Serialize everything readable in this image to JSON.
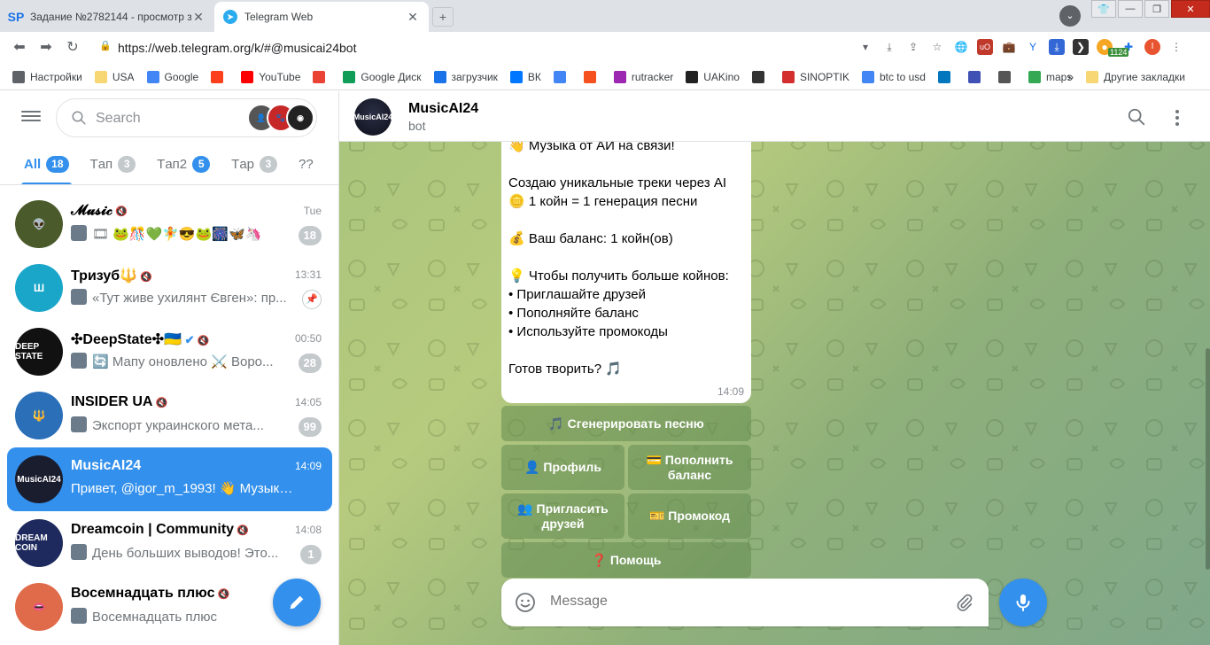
{
  "browser": {
    "tabs": [
      {
        "title": "Задание №2782144 - просмотр з",
        "favicon": "SP"
      },
      {
        "title": "Telegram Web",
        "favicon": "telegram-icon"
      }
    ],
    "profile_initial": "I",
    "url": "https://web.telegram.org/k/#@musicai24bot",
    "extension_badge": "1124",
    "bookmarks": [
      {
        "label": "Настройки",
        "icon": "gear-icon"
      },
      {
        "label": "USA",
        "icon": "folder-icon"
      },
      {
        "label": "Google",
        "icon": "google-icon"
      },
      {
        "label": "",
        "icon": "yandex-icon"
      },
      {
        "label": "YouTube",
        "icon": "youtube-icon"
      },
      {
        "label": "",
        "icon": "gmail-icon"
      },
      {
        "label": "Google Диск",
        "icon": "drive-icon"
      },
      {
        "label": "загрузчик",
        "icon": "link-icon"
      },
      {
        "label": "ВК",
        "icon": "vk-icon"
      },
      {
        "label": "",
        "icon": "translate-icon"
      },
      {
        "label": "",
        "icon": "f-icon"
      },
      {
        "label": "rutracker",
        "icon": "rutracker-icon"
      },
      {
        "label": "UAKino",
        "icon": "film-icon"
      },
      {
        "label": "",
        "icon": "chess-icon"
      },
      {
        "label": "SINOPTIK",
        "icon": "thermometer-icon"
      },
      {
        "label": "btc to usd",
        "icon": "google-icon"
      },
      {
        "label": "",
        "icon": "p-icon"
      },
      {
        "label": "",
        "icon": "arrow-icon"
      },
      {
        "label": "",
        "icon": "bc-icon"
      },
      {
        "label": "maps",
        "icon": "maps-icon"
      }
    ],
    "more_bookmarks": "»",
    "other_bookmarks": "Другие закладки"
  },
  "sidebar": {
    "search_placeholder": "Search",
    "folders": [
      {
        "label": "All",
        "count": "18",
        "active": true
      },
      {
        "label": "Tап",
        "count": "3"
      },
      {
        "label": "Tап2",
        "count": "5"
      },
      {
        "label": "Tар",
        "count": "3"
      },
      {
        "label": "??",
        "count": ""
      }
    ],
    "chats": [
      {
        "name": "𝓜𝓾𝓼𝓲𝓬",
        "muted": true,
        "time": "Tue",
        "preview": "🎞 🐸🎊💚🧚😎🐸🎆🦋🦄",
        "unread": "18",
        "avatar_color": "#4a5a2a",
        "avatar_text": "👽"
      },
      {
        "name": "Тризуб🔱",
        "muted": true,
        "time": "13:31",
        "preview": "«Тут живе ухилянт Євген»: пр...",
        "unread": "",
        "pinned": true,
        "avatar_color": "#1aa6c9",
        "avatar_text": "Ш"
      },
      {
        "name": "✣DeepState✣🇺🇦",
        "muted": true,
        "verified": true,
        "time": "00:50",
        "preview": "🔄 Мапу оновлено ⚔️ Воро...",
        "unread": "28",
        "avatar_color": "#111111",
        "avatar_text": "DEEP STATE"
      },
      {
        "name": "INSIDER UA",
        "muted": true,
        "time": "14:05",
        "preview": "Экспорт украинского мета...",
        "unread": "99",
        "avatar_color": "#2a6fb8",
        "avatar_text": "🔱"
      },
      {
        "name": "MusicAI24",
        "muted": false,
        "time": "14:09",
        "preview": "Привет, @igor_m_1993! 👋 Музыка о...",
        "unread": "",
        "active": true,
        "avatar_color": "#1a1d2e",
        "avatar_text": "MusicAI24"
      },
      {
        "name": "Dreamcoin | Community",
        "muted": true,
        "time": "14:08",
        "preview": "День больших выводов! Это...",
        "unread": "1",
        "avatar_color": "#1e2a5e",
        "avatar_text": "DREAM COIN"
      },
      {
        "name": "Восемнадцать плюс",
        "muted": true,
        "time": "",
        "preview": "Восемнадцать плюс",
        "unread": "",
        "avatar_color": "#e06b4a",
        "avatar_text": "👄"
      }
    ]
  },
  "chat": {
    "title": "MusicAI24",
    "subtitle": "bot",
    "message": {
      "lines": [
        "👋 Музыка от АИ на связи!",
        "",
        "Создаю уникальные треки через AI",
        "🪙 1 койн = 1 генерация песни",
        "",
        "💰 Ваш баланс: 1 койн(ов)",
        "",
        "💡 Чтобы получить больше койнов:",
        "• Приглашайте друзей",
        "• Пополняйте баланс",
        "• Используйте промокоды",
        "",
        "Готов творить? 🎵"
      ],
      "time": "14:09"
    },
    "keyboard": [
      [
        {
          "label": "🎵 Сгенерировать песню"
        }
      ],
      [
        {
          "label": "👤 Профиль"
        },
        {
          "label": "💳 Пополнить баланс"
        }
      ],
      [
        {
          "label": "👥 Пригласить друзей"
        },
        {
          "label": "🎫 Промокод"
        }
      ],
      [
        {
          "label": "❓ Помощь"
        }
      ]
    ],
    "composer_placeholder": "Message"
  }
}
